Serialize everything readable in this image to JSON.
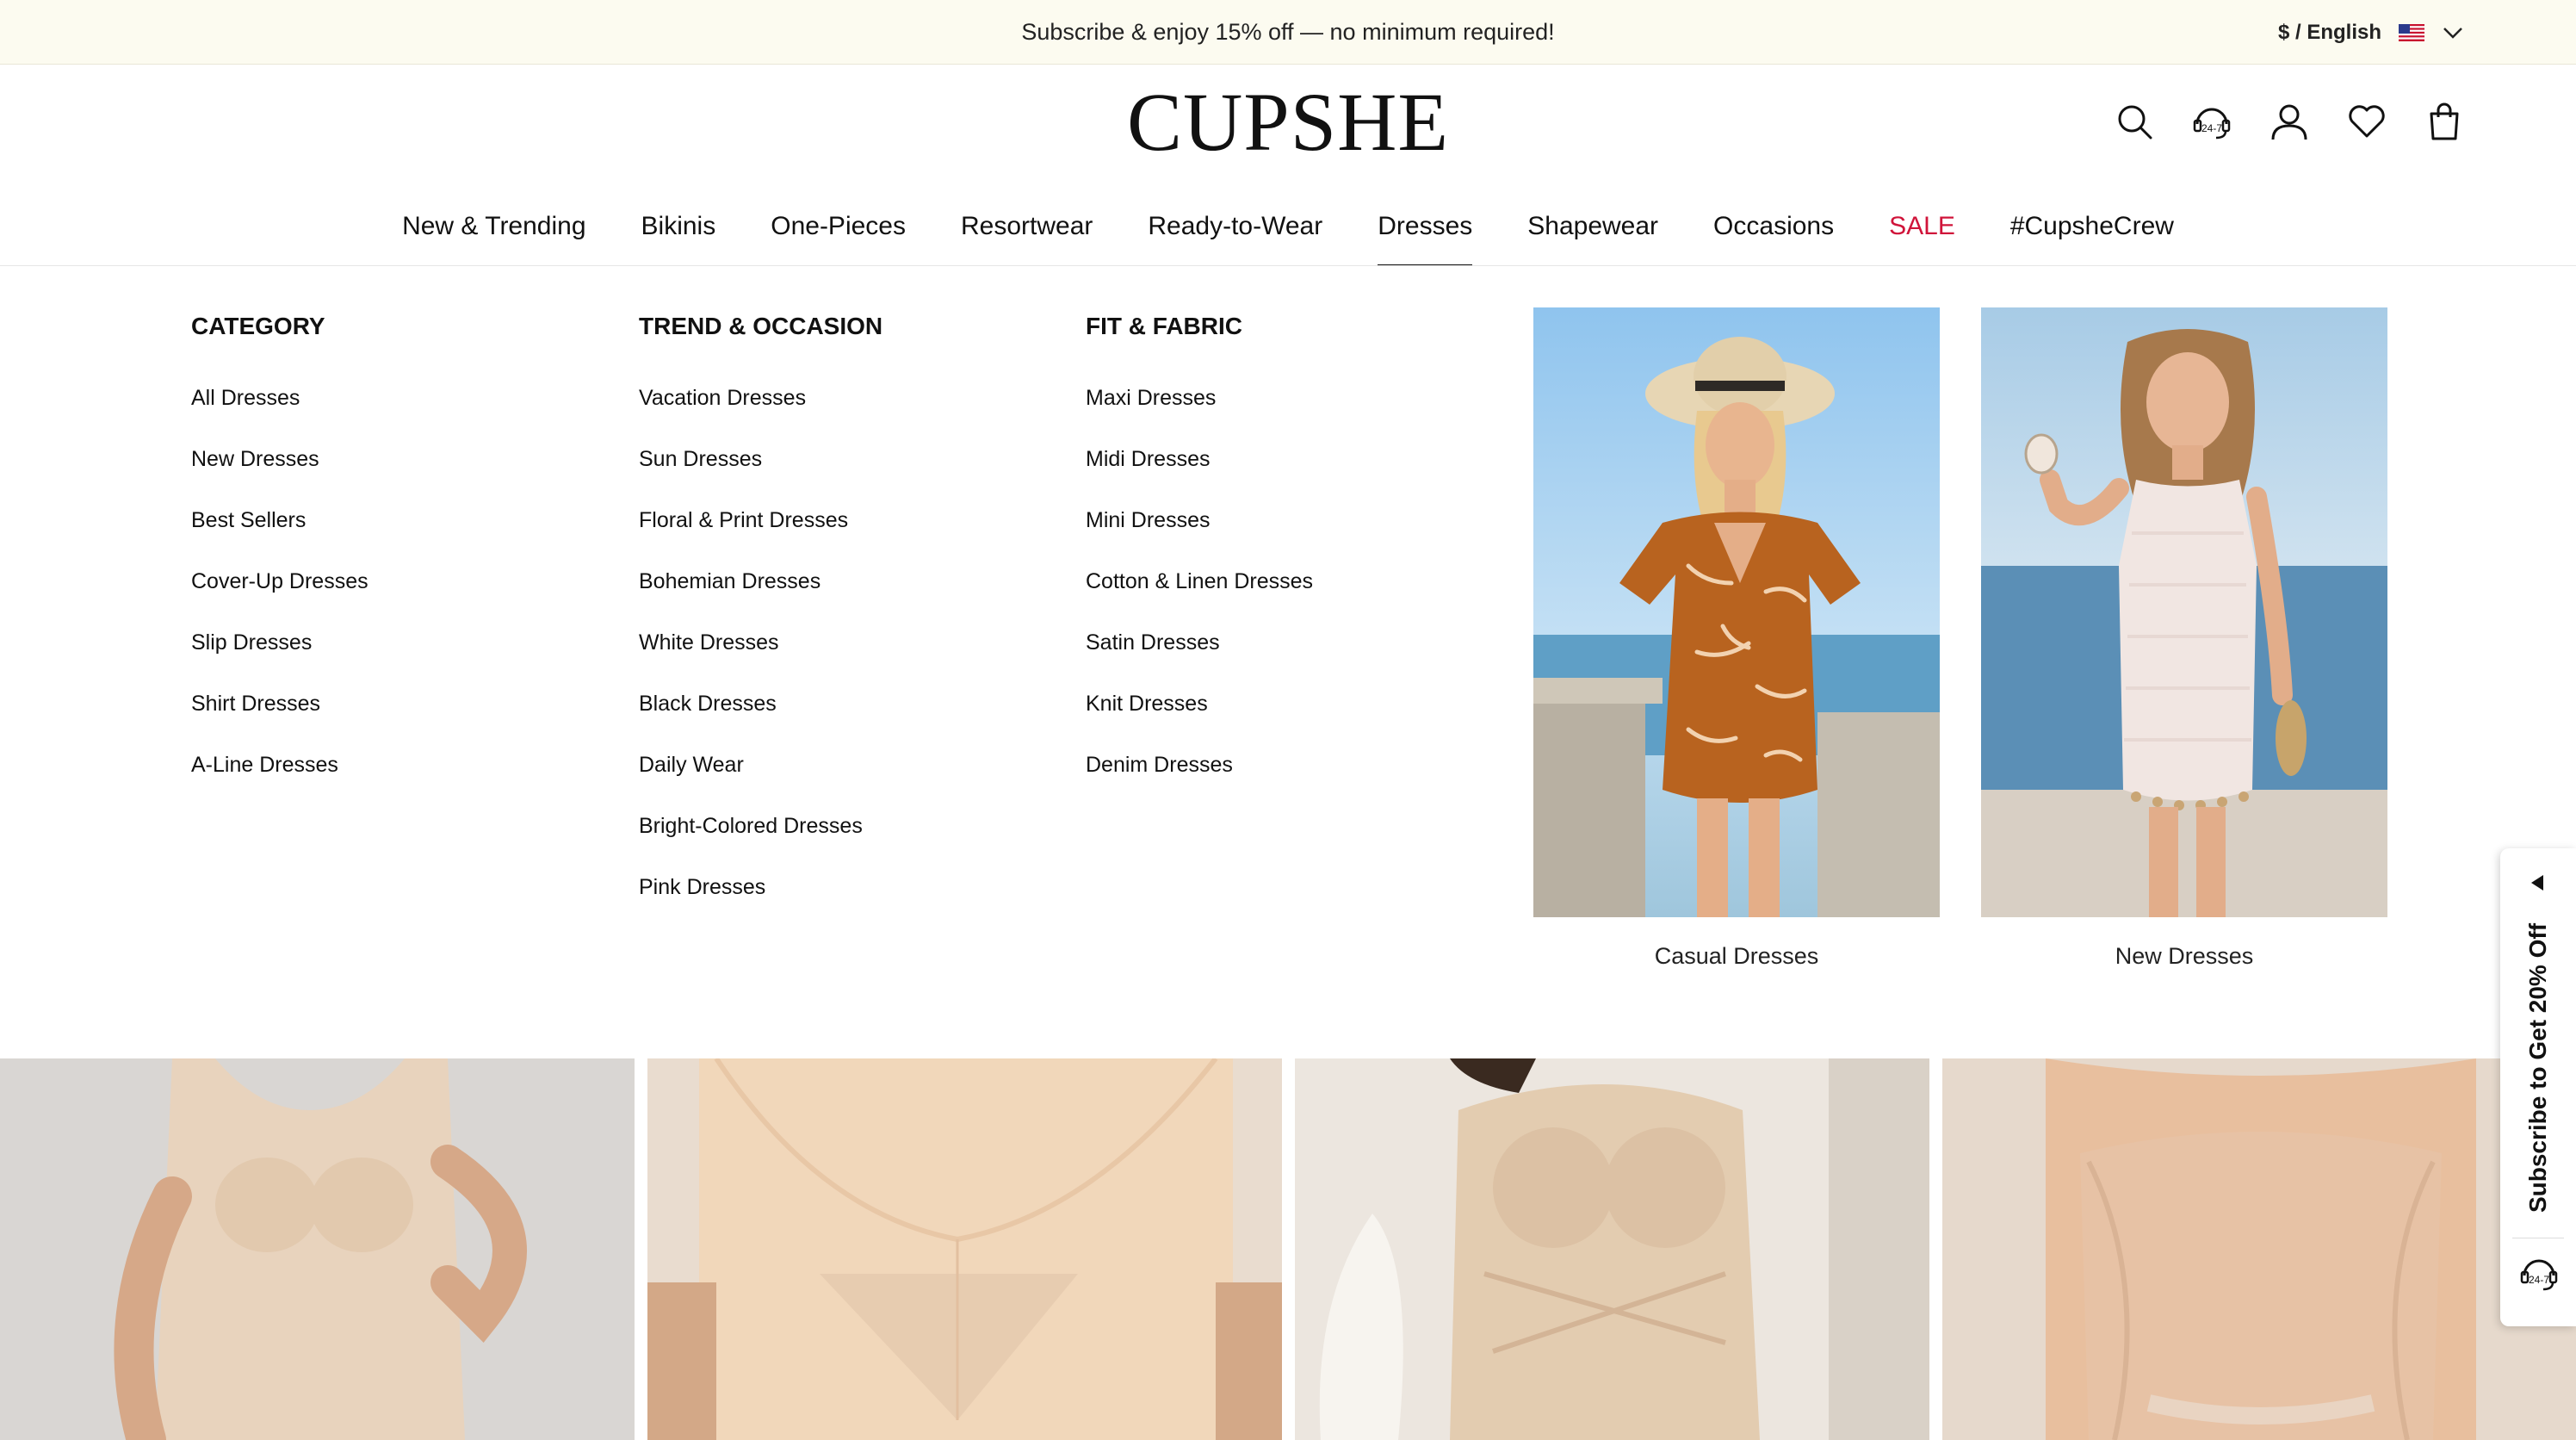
{
  "promo_bar": {
    "text": "Subscribe & enjoy 15% off — no minimum required!",
    "locale": "$ / English"
  },
  "header": {
    "logo": "CUPSHE",
    "icons": [
      "search-icon",
      "support-24-7-icon",
      "account-icon",
      "wishlist-icon",
      "bag-icon"
    ],
    "support_label": "24-7"
  },
  "nav": {
    "items": [
      "New & Trending",
      "Bikinis",
      "One-Pieces",
      "Resortwear",
      "Ready-to-Wear",
      "Dresses",
      "Shapewear",
      "Occasions",
      "SALE",
      "#CupsheCrew"
    ],
    "active": "Dresses",
    "sale_color": "#d0143a"
  },
  "mega_menu": {
    "columns": [
      {
        "heading": "CATEGORY",
        "links": [
          "All Dresses",
          "New Dresses",
          "Best Sellers",
          "Cover-Up Dresses",
          "Slip Dresses",
          "Shirt Dresses",
          "A-Line Dresses"
        ]
      },
      {
        "heading": "TREND & OCCASION",
        "links": [
          "Vacation Dresses",
          "Sun Dresses",
          "Floral & Print Dresses",
          "Bohemian Dresses",
          "White Dresses",
          "Black Dresses",
          "Daily Wear",
          "Bright-Colored Dresses",
          "Pink Dresses"
        ]
      },
      {
        "heading": "FIT & FABRIC",
        "links": [
          "Maxi Dresses",
          "Midi Dresses",
          "Mini Dresses",
          "Cotton & Linen Dresses",
          "Satin Dresses",
          "Knit Dresses",
          "Denim Dresses"
        ]
      }
    ],
    "promos": [
      {
        "caption": "Casual Dresses"
      },
      {
        "caption": "New Dresses"
      }
    ]
  },
  "side_tab": {
    "text": "Subscribe to Get 20% Off",
    "chat_label": "24-7"
  }
}
